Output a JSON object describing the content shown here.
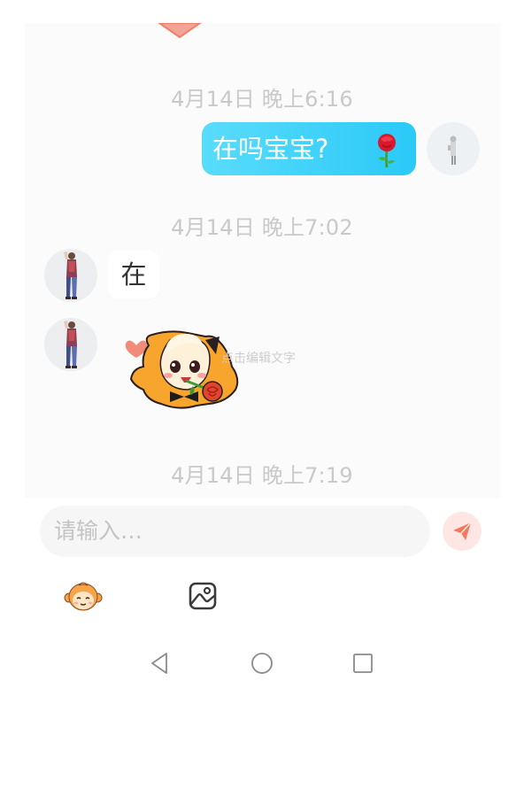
{
  "chat": {
    "timestamps": [
      "4月14日 晚上6:16",
      "4月14日 晚上7:02",
      "4月14日 晚上7:19"
    ],
    "messages": [
      {
        "direction": "outgoing",
        "text": "在吗宝宝?",
        "emoji": "rose-icon"
      },
      {
        "direction": "incoming",
        "text": "在"
      },
      {
        "direction": "incoming",
        "type": "sticker",
        "sticker": "girl-holding-rose-sticker",
        "watermark": "点击编辑文字"
      }
    ]
  },
  "composer": {
    "placeholder": "请输入…",
    "send_icon": "send-icon"
  },
  "toolbar": {
    "icons": [
      "monkey-emoji-icon",
      "image-icon"
    ]
  },
  "system_nav": {
    "icons": [
      "back-triangle-icon",
      "home-circle-icon",
      "recent-square-icon"
    ]
  },
  "colors": {
    "outgoing_bubble": "#2bc9f7",
    "send_button": "#f4775e",
    "timestamp": "#c9c9c9"
  }
}
